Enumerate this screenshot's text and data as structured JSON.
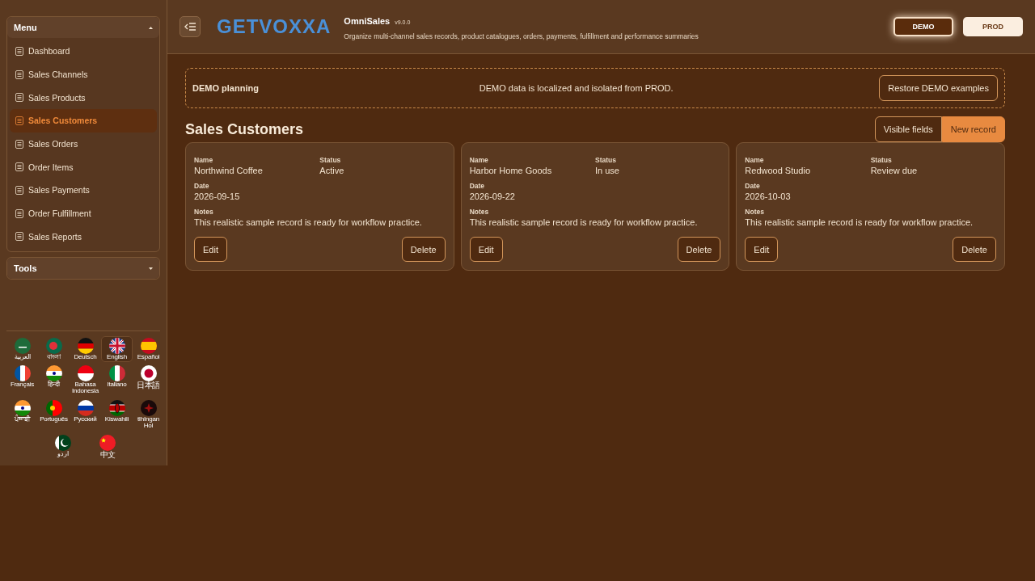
{
  "sidebar": {
    "sections": [
      {
        "title": "Menu",
        "expanded": true,
        "items": [
          {
            "label": "Dashboard",
            "selected": false
          },
          {
            "label": "Sales Channels",
            "selected": false
          },
          {
            "label": "Sales Products",
            "selected": false
          },
          {
            "label": "Sales Customers",
            "selected": true
          },
          {
            "label": "Sales Orders",
            "selected": false
          },
          {
            "label": "Order Items",
            "selected": false
          },
          {
            "label": "Sales Payments",
            "selected": false
          },
          {
            "label": "Order Fulfillment",
            "selected": false
          },
          {
            "label": "Sales Reports",
            "selected": false
          }
        ]
      },
      {
        "title": "Tools",
        "expanded": false
      }
    ],
    "languages": [
      {
        "label": "العربية",
        "selected": false
      },
      {
        "label": "বাংলা",
        "selected": false
      },
      {
        "label": "Deutsch",
        "selected": false
      },
      {
        "label": "English",
        "selected": true
      },
      {
        "label": "Español",
        "selected": false
      },
      {
        "label": "Français",
        "selected": false
      },
      {
        "label": "हिन्दी",
        "selected": false
      },
      {
        "label": "Bahasa Indonesia",
        "selected": false
      },
      {
        "label": "Italiano",
        "selected": false
      },
      {
        "label": "日本語",
        "selected": false
      },
      {
        "label": "ਪੰਜਾਬੀ",
        "selected": false
      },
      {
        "label": "Português",
        "selected": false
      },
      {
        "label": "Русский",
        "selected": false
      },
      {
        "label": "Kiswahili",
        "selected": false
      },
      {
        "label": "tlhIngan Hol",
        "selected": false
      },
      {
        "label": "اردو",
        "selected": false
      },
      {
        "label": "中文",
        "selected": false
      }
    ]
  },
  "header": {
    "logo": "GETVOXXA",
    "app_name": "OmniSales",
    "version": "v9.0.0",
    "subtitle": "Organize multi-channel sales records, product catalogues, orders, payments, fulfillment and performance summaries",
    "environments": [
      {
        "label": "DEMO",
        "selected": true
      },
      {
        "label": "PROD",
        "selected": false
      }
    ]
  },
  "banner": {
    "title": "DEMO planning",
    "message": "DEMO data is localized and isolated from PROD.",
    "button": "Restore DEMO examples"
  },
  "page": {
    "title": "Sales Customers",
    "buttons": [
      {
        "label": "Visible fields",
        "kind": "outline"
      },
      {
        "label": "New record",
        "kind": "primary"
      }
    ]
  },
  "cards": [
    {
      "name_label": "Name",
      "name": "Northwind Coffee",
      "status_label": "Status",
      "status": "Active",
      "date_label": "Date",
      "date": "2026-09-15",
      "notes_label": "Notes",
      "notes": "This realistic sample record is ready for workflow practice.",
      "edit": "Edit",
      "delete": "Delete"
    },
    {
      "name_label": "Name",
      "name": "Harbor Home Goods",
      "status_label": "Status",
      "status": "In use",
      "date_label": "Date",
      "date": "2026-09-22",
      "notes_label": "Notes",
      "notes": "This realistic sample record is ready for workflow practice.",
      "edit": "Edit",
      "delete": "Delete"
    },
    {
      "name_label": "Name",
      "name": "Redwood Studio",
      "status_label": "Status",
      "status": "Review due",
      "date_label": "Date",
      "date": "2026-10-03",
      "notes_label": "Notes",
      "notes": "This realistic sample record is ready for workflow practice.",
      "edit": "Edit",
      "delete": "Delete"
    }
  ]
}
